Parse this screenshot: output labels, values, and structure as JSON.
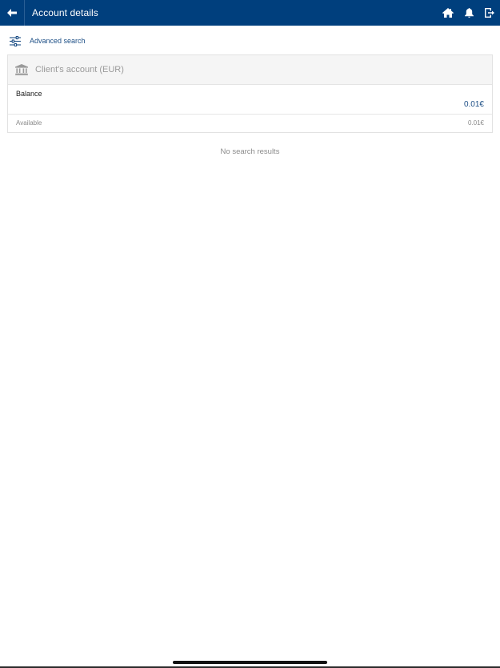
{
  "header": {
    "title": "Account details",
    "back_icon": "arrow-left-icon",
    "actions": [
      "home-icon",
      "bell-icon",
      "logout-icon"
    ],
    "background_color": "#003f7d"
  },
  "advanced_search": {
    "label": "Advanced search",
    "icon": "sliders-icon"
  },
  "account": {
    "icon": "bank-icon",
    "title": "Client's account (EUR)",
    "balance_label": "Balance",
    "balance_value": "0.01€",
    "available_label": "Available",
    "available_value": "0.01€"
  },
  "results": {
    "empty_message": "No search results"
  },
  "colors": {
    "accent": "#1d4f86",
    "muted": "#8c8c8c"
  }
}
